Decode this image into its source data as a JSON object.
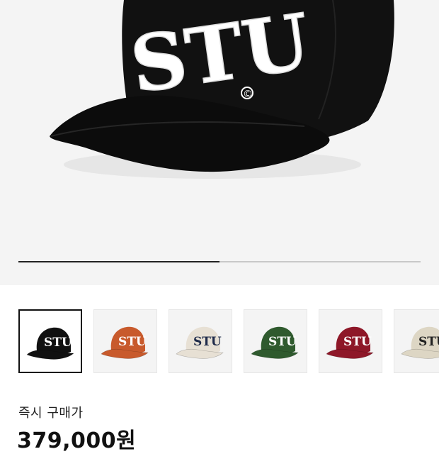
{
  "product": {
    "hero_image": "black-stu-arch-cap",
    "cap_text": "STU",
    "copyright_mark": "©",
    "gallery_progress": 0.5
  },
  "variants": [
    {
      "color": "#111111",
      "logo_color": "#ffffff",
      "selected": true
    },
    {
      "color": "#c85a2c",
      "logo_color": "#ffffff",
      "selected": false
    },
    {
      "color": "#e7e0d4",
      "logo_color": "#1f2b4a",
      "selected": false
    },
    {
      "color": "#2f5a2e",
      "logo_color": "#ffffff",
      "selected": false
    },
    {
      "color": "#8e1728",
      "logo_color": "#ffffff",
      "selected": false
    },
    {
      "color": "#ddd6c4",
      "logo_color": "#222222",
      "selected": false
    }
  ],
  "price": {
    "label": "즉시 구매가",
    "value": "379,000원"
  }
}
